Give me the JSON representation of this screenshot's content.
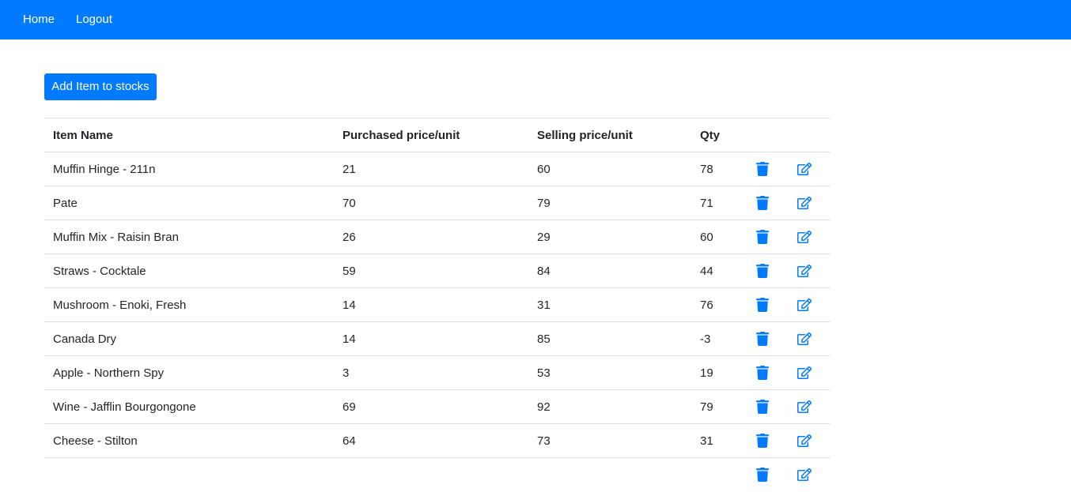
{
  "nav": {
    "home_label": "Home",
    "logout_label": "Logout"
  },
  "actions": {
    "add_label": "Add Item to stocks"
  },
  "table": {
    "headers": {
      "name": "Item Name",
      "purchased": "Purchased price/unit",
      "selling": "Selling price/unit",
      "qty": "Qty"
    },
    "rows": [
      {
        "name": "Muffin Hinge - 211n",
        "purchased": "21",
        "selling": "60",
        "qty": "78"
      },
      {
        "name": "Pate",
        "purchased": "70",
        "selling": "79",
        "qty": "71"
      },
      {
        "name": "Muffin Mix - Raisin Bran",
        "purchased": "26",
        "selling": "29",
        "qty": "60"
      },
      {
        "name": "Straws - Cocktale",
        "purchased": "59",
        "selling": "84",
        "qty": "44"
      },
      {
        "name": "Mushroom - Enoki, Fresh",
        "purchased": "14",
        "selling": "31",
        "qty": "76"
      },
      {
        "name": "Canada Dry",
        "purchased": "14",
        "selling": "85",
        "qty": "-3"
      },
      {
        "name": "Apple - Northern Spy",
        "purchased": "3",
        "selling": "53",
        "qty": "19"
      },
      {
        "name": "Wine - Jafflin Bourgongone",
        "purchased": "69",
        "selling": "92",
        "qty": "79"
      },
      {
        "name": "Cheese - Stilton",
        "purchased": "64",
        "selling": "73",
        "qty": "31"
      },
      {
        "name": "",
        "purchased": "",
        "selling": "",
        "qty": ""
      }
    ]
  },
  "icons": {
    "delete": "trash-icon",
    "edit": "edit-icon"
  },
  "colors": {
    "primary": "#007bff",
    "text": "#212529",
    "border": "#dee2e6"
  }
}
